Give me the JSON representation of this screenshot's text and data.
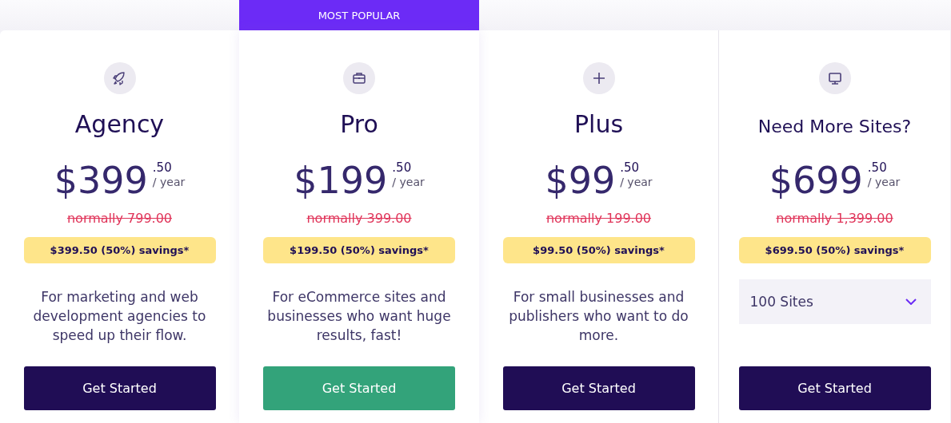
{
  "plans": [
    {
      "name": "Agency",
      "featured": false,
      "price": "$399",
      "cents": ".50",
      "period": "/ year",
      "normally": "normally 799.00",
      "savings": "$399.50 (50%) savings*",
      "kind": "description",
      "description": "For marketing and web development agencies to speed up their flow.",
      "button": "Get Started"
    },
    {
      "name": "Pro",
      "featured": true,
      "badge": "MOST POPULAR",
      "price": "$199",
      "cents": ".50",
      "period": "/ year",
      "normally": "normally 399.00",
      "savings": "$199.50 (50%) savings*",
      "kind": "description",
      "description": "For eCommerce sites and businesses who want huge results, fast!",
      "button": "Get Started"
    },
    {
      "name": "Plus",
      "featured": false,
      "price": "$99",
      "cents": ".50",
      "period": "/ year",
      "normally": "normally 199.00",
      "savings": "$99.50 (50%) savings*",
      "kind": "description",
      "description": "For small businesses and publishers who want to do more.",
      "button": "Get Started"
    },
    {
      "name": "Need More Sites?",
      "featured": false,
      "price": "$699",
      "cents": ".50",
      "period": "/ year",
      "normally": "normally 1,399.00",
      "savings": "$699.50 (50%) savings*",
      "kind": "dropdown",
      "select": "100 Sites",
      "button": "Get Started"
    }
  ]
}
